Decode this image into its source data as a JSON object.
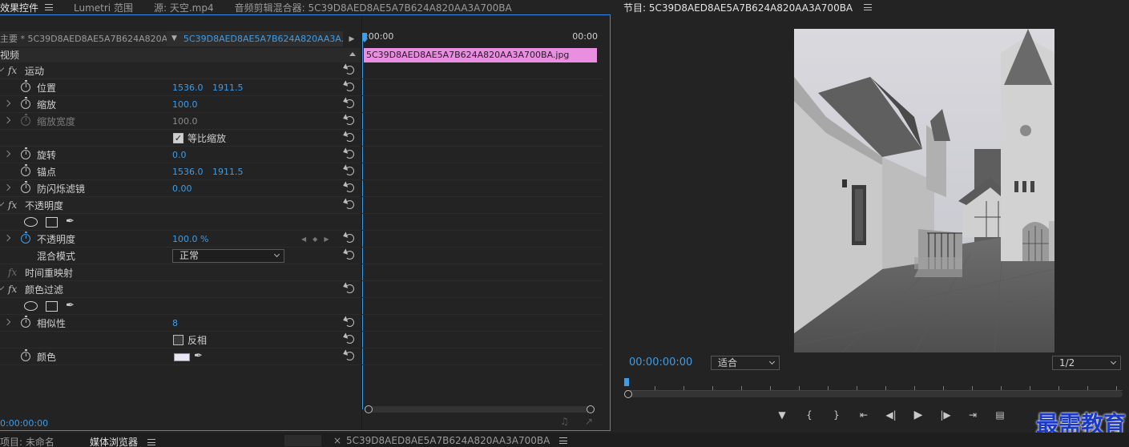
{
  "left_tabs": [
    {
      "label": "效果控件",
      "active": true
    },
    {
      "label": "Lumetri 范围",
      "active": false
    },
    {
      "label": "源: 天空.mp4",
      "active": false
    },
    {
      "label": "音频剪辑混合器: 5C39D8AED8AE5A7B624A820AA3A700BA",
      "active": false
    }
  ],
  "program_tab": {
    "label": "节目: 5C39D8AED8AE5A7B624A820AA3A700BA"
  },
  "source": {
    "master": "主要 * 5C39D8AED8AE5A7B624A820A...",
    "clip": "5C39D8AED8AE5A7B624A820AA3A..."
  },
  "section_label": "视频",
  "rows": {
    "motion": "运动",
    "position": {
      "name": "位置",
      "x": "1536.0",
      "y": "1911.5"
    },
    "scale": {
      "name": "缩放",
      "value": "100.0"
    },
    "scale_width": {
      "name": "缩放宽度",
      "value": "100.0"
    },
    "uniform_scale": {
      "label": "等比缩放"
    },
    "rotation": {
      "name": "旋转",
      "value": "0.0"
    },
    "anchor": {
      "name": "锚点",
      "x": "1536.0",
      "y": "1911.5"
    },
    "antiflicker": {
      "name": "防闪烁滤镜",
      "value": "0.00"
    },
    "opacity_group": "不透明度",
    "opacity": {
      "name": "不透明度",
      "value": "100.0 %"
    },
    "blend": {
      "name": "混合模式",
      "value": "正常"
    },
    "time_remap": "时间重映射",
    "color_pass": "颜色过滤",
    "similarity": {
      "name": "相似性",
      "value": "8"
    },
    "invert": {
      "label": "反相"
    },
    "color": {
      "name": "颜色",
      "swatch": "#e7e6f4"
    }
  },
  "ec_timeline": {
    "start": ":00:00",
    "end": "00:00",
    "clip_label": "5C39D8AED8AE5A7B624A820AA3A700BA.jpg",
    "clip_color": "#e98ee0"
  },
  "ec_timecode": "0:00:00:00",
  "program": {
    "timecode": "00:00:00:00",
    "fit": "适合",
    "resolution": "1/2"
  },
  "watermark": "最需教育",
  "bottom": {
    "project": "项目: 未命名",
    "media_browser": "媒体浏览器",
    "sequence_tab": "5C39D8AED8AE5A7B624A820AA3A700BA"
  },
  "colors": {
    "accent": "#3f9ce6",
    "panel": "#232323"
  }
}
